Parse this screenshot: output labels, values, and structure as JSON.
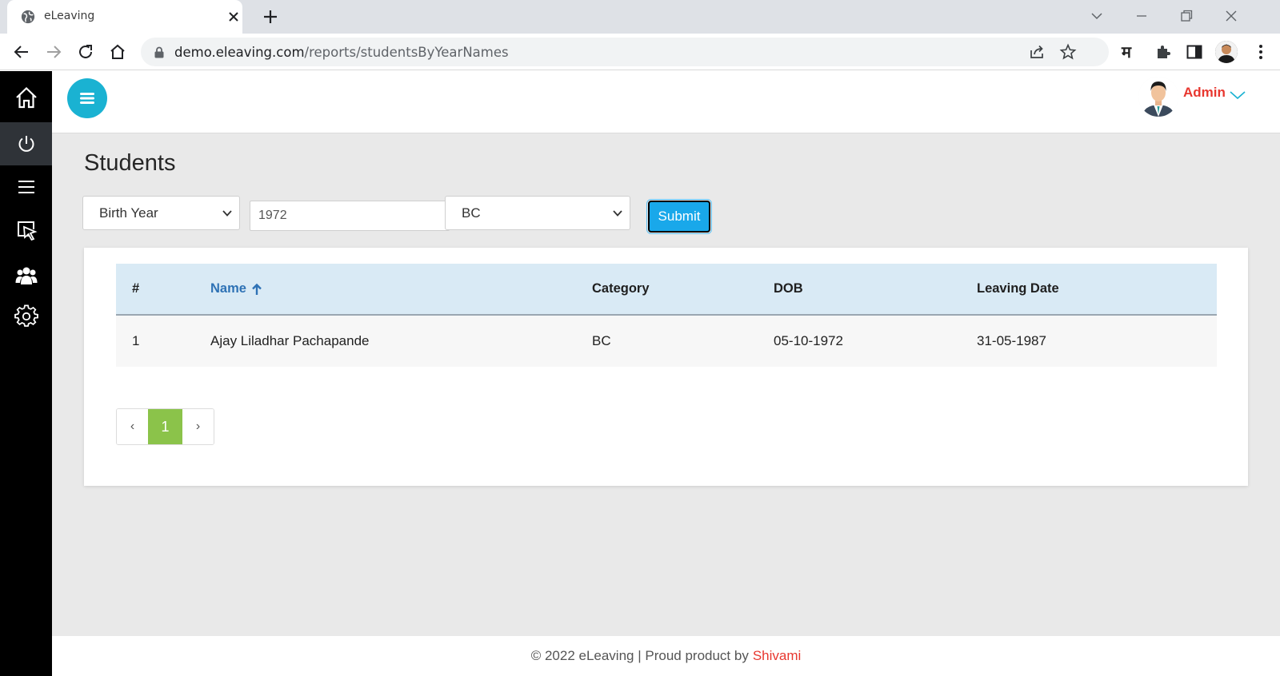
{
  "browser": {
    "tab_title": "eLeaving",
    "url_host": "demo.eleaving.com",
    "url_path": "/reports/studentsByYearNames",
    "extension_label": "म"
  },
  "sidebar": {
    "items": [
      {
        "icon": "home-icon"
      },
      {
        "icon": "power-icon",
        "active": true
      },
      {
        "icon": "list-icon"
      },
      {
        "icon": "cursor-select-icon"
      },
      {
        "icon": "users-icon"
      },
      {
        "icon": "settings-icon"
      }
    ]
  },
  "header": {
    "user_name": "Admin"
  },
  "page": {
    "title": "Students"
  },
  "filters": {
    "field_select": "Birth Year",
    "value_input": "1972",
    "category_select": "BC",
    "submit_label": "Submit"
  },
  "table": {
    "headers": [
      "#",
      "Name",
      "Category",
      "DOB",
      "Leaving Date"
    ],
    "sorted_column": "Name",
    "rows": [
      [
        "1",
        "Ajay Liladhar Pachapande",
        "BC",
        "05-10-1972",
        "31-05-1987"
      ]
    ]
  },
  "pagination": {
    "prev": "‹",
    "current": "1",
    "next": "›"
  },
  "footer": {
    "text": "© 2022 eLeaving | Proud product by",
    "brand": "Shivami"
  },
  "colors": {
    "accent": "#1ab2d2",
    "brand_red": "#e8372f",
    "submit": "#19a8ea",
    "page_active": "#8bc34a",
    "table_header": "#d9eaf5"
  }
}
